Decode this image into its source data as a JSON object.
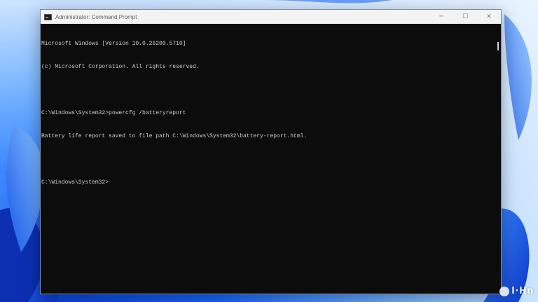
{
  "window": {
    "title": "Administrator: Command Prompt",
    "controls": {
      "minimize": "─",
      "maximize": "☐",
      "close": "✕"
    }
  },
  "console": {
    "lines": [
      "Microsoft Windows [Version 10.0.26200.5710]",
      "(c) Microsoft Corporation. All rights reserved.",
      "",
      "C:\\Windows\\System32>powercfg /batteryreport",
      "Battery life report saved to file path C:\\Windows\\System32\\battery-report.html.",
      "",
      "C:\\Windows\\System32>"
    ]
  },
  "watermark": {
    "text": "I·Hn"
  },
  "colors": {
    "console_bg": "#0c0c0c",
    "console_text": "#cccccc",
    "titlebar_bg": "#f3f3f3"
  }
}
